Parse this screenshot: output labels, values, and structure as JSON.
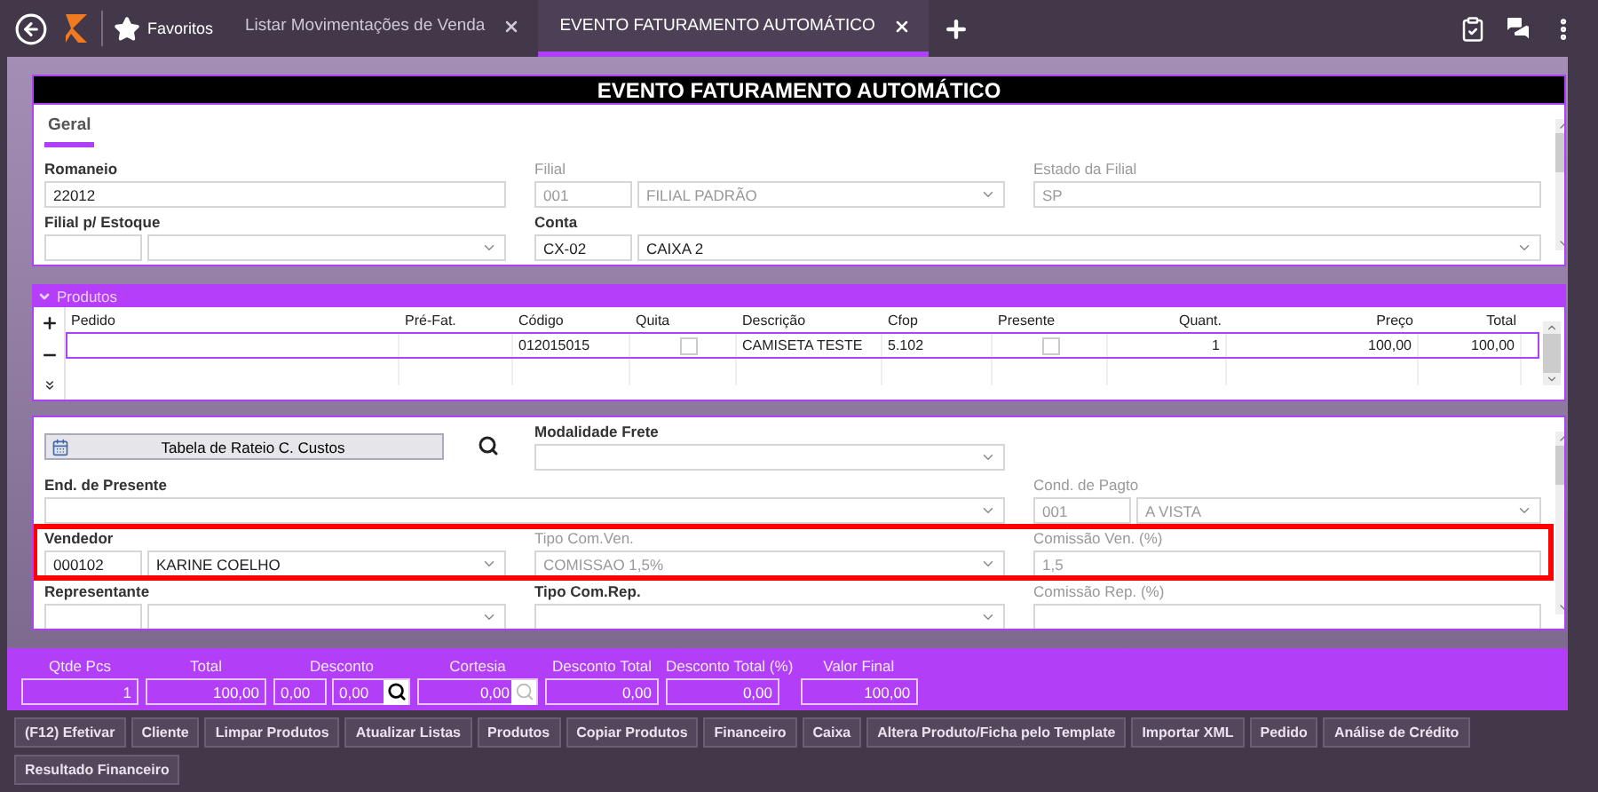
{
  "topbar": {
    "favorites": "Favoritos",
    "tabs": [
      {
        "label": "Listar Movimentações de Venda",
        "selected": false
      },
      {
        "label": "EVENTO FATURAMENTO AUTOMÁTICO",
        "selected": true
      }
    ]
  },
  "form": {
    "title": "EVENTO FATURAMENTO AUTOMÁTICO",
    "tabs": [
      {
        "label": "Geral",
        "selected": true
      }
    ],
    "general": [
      [
        {
          "kind": "normal",
          "label": "Romaneio",
          "disabled": false,
          "inputs": [
            {
              "kind": "text",
              "value": "22012"
            }
          ]
        },
        {
          "kind": "normal",
          "label": "Filial",
          "disabled": true,
          "inputs": [
            {
              "kind": "code",
              "value": "001"
            },
            {
              "kind": "select",
              "value": "FILIAL PADRÃO"
            }
          ]
        },
        {
          "kind": "normal",
          "label": "Estado da Filial",
          "disabled": true,
          "inputs": [
            {
              "kind": "text",
              "value": "SP"
            }
          ]
        }
      ],
      [
        {
          "kind": "normal",
          "label": "Filial p/ Estoque",
          "disabled": false,
          "inputs": [
            {
              "kind": "code"
            },
            {
              "kind": "select"
            }
          ]
        },
        {
          "kind": "wide",
          "label": "Conta",
          "disabled": false,
          "inputs": [
            {
              "kind": "code",
              "value": "CX-02"
            },
            {
              "kind": "select",
              "value": "CAIXA 2"
            }
          ]
        }
      ]
    ],
    "products": {
      "title": "Produtos",
      "columns": [
        {
          "label": "Pedido",
          "kind": "text"
        },
        {
          "label": "Pré-Fat.",
          "kind": "text"
        },
        {
          "label": "Código",
          "kind": "text"
        },
        {
          "label": "Quita",
          "kind": "text"
        },
        {
          "label": "Descrição",
          "kind": "text"
        },
        {
          "label": "Cfop",
          "kind": "text"
        },
        {
          "label": "Presente",
          "kind": "text"
        },
        {
          "label": "Quant.",
          "kind": "number"
        },
        {
          "label": "Preço",
          "kind": "number"
        },
        {
          "label": "Total",
          "kind": "number"
        }
      ],
      "rows": [
        {
          "selected": true,
          "cells": [
            {
              "kind": "empty"
            },
            {
              "kind": "empty"
            },
            {
              "kind": "text",
              "text": "012015015"
            },
            {
              "kind": "check",
              "checked": false
            },
            {
              "kind": "text",
              "text": "CAMISETA TESTE"
            },
            {
              "kind": "text",
              "text": "5.102"
            },
            {
              "kind": "check",
              "checked": false
            },
            {
              "kind": "text",
              "text": "1"
            },
            {
              "kind": "text",
              "text": "100,00"
            },
            {
              "kind": "text",
              "text": "100,00"
            }
          ]
        }
      ]
    },
    "details": [
      {
        "highlighted": false,
        "items": [
          {
            "kind": "action",
            "label": "Tabela de Rateio C. Custos"
          },
          {
            "kind": "normal",
            "label": "Modalidade Frete",
            "disabled": false,
            "inputs": [
              {
                "kind": "select"
              }
            ]
          }
        ]
      },
      {
        "highlighted": false,
        "items": [
          {
            "kind": "wide",
            "label": "End. de Presente",
            "disabled": false,
            "inputs": [
              {
                "kind": "select"
              }
            ]
          },
          {
            "kind": "normal",
            "label": "Cond. de Pagto",
            "disabled": true,
            "inputs": [
              {
                "kind": "code",
                "value": "001"
              },
              {
                "kind": "select",
                "value": "A VISTA"
              }
            ]
          }
        ]
      },
      {
        "highlighted": true,
        "items": [
          {
            "kind": "normal",
            "label": "Vendedor",
            "disabled": false,
            "inputs": [
              {
                "kind": "code",
                "value": "000102"
              },
              {
                "kind": "select",
                "value": "KARINE COELHO"
              }
            ]
          },
          {
            "kind": "normal",
            "label": "Tipo Com.Ven.",
            "disabled": true,
            "inputs": [
              {
                "kind": "select",
                "value": "COMISSAO 1,5%"
              }
            ]
          },
          {
            "kind": "normal",
            "label": "Comissão Ven. (%)",
            "disabled": true,
            "inputs": [
              {
                "kind": "text",
                "value": "1,5"
              }
            ]
          }
        ]
      },
      {
        "highlighted": false,
        "items": [
          {
            "kind": "normal",
            "label": "Representante",
            "disabled": false,
            "inputs": [
              {
                "kind": "code"
              },
              {
                "kind": "select"
              }
            ]
          },
          {
            "kind": "normal",
            "label": "Tipo Com.Rep.",
            "disabled": false,
            "inputs": [
              {
                "kind": "select"
              }
            ]
          },
          {
            "kind": "normal",
            "label": "Comissão Rep. (%)",
            "disabled": true,
            "inputs": [
              {
                "kind": "text"
              }
            ]
          }
        ]
      }
    ]
  },
  "totals": [
    {
      "label": "Qtde Pcs",
      "inputs": [
        {
          "kind": "text",
          "value": "1"
        }
      ]
    },
    {
      "label": "Total",
      "inputs": [
        {
          "kind": "text",
          "value": "100,00"
        }
      ]
    },
    {
      "label": "Desconto",
      "inputs": [
        {
          "kind": "small",
          "value": "0,00"
        },
        {
          "kind": "lookup",
          "value": "0,00",
          "disabled": false
        }
      ]
    },
    {
      "label": "Cortesia",
      "inputs": [
        {
          "kind": "lookup-right",
          "value": "0,00",
          "disabled": true
        }
      ]
    },
    {
      "label": "Desconto Total",
      "inputs": [
        {
          "kind": "text",
          "value": "0,00"
        }
      ]
    },
    {
      "label": "Desconto Total (%)",
      "inputs": [
        {
          "kind": "text",
          "value": "0,00"
        }
      ]
    },
    {
      "label": "Valor Final",
      "inputs": [
        {
          "kind": "text",
          "value": "100,00"
        }
      ]
    }
  ],
  "actions": [
    "(F12) Efetivar",
    "Cliente",
    "Limpar Produtos",
    "Atualizar Listas",
    "Produtos",
    "Copiar Produtos",
    "Financeiro",
    "Caixa",
    "Altera Produto/Ficha pelo Template",
    "Importar XML",
    "Pedido",
    "Análise de Crédito",
    "Resultado Financeiro"
  ]
}
